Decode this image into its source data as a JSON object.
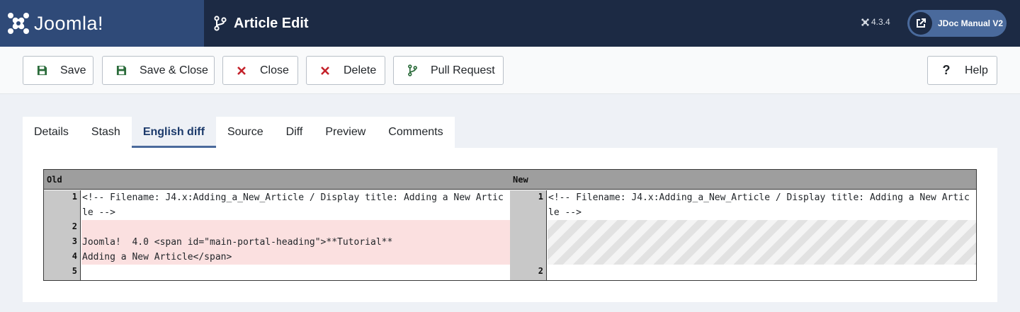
{
  "header": {
    "brand": "Joomla!",
    "title": "Article Edit",
    "version": "4.3.4",
    "manual_button": "JDoc Manual V2"
  },
  "toolbar": {
    "save": "Save",
    "save_close": "Save & Close",
    "close": "Close",
    "delete": "Delete",
    "pull_request": "Pull Request",
    "help": "Help"
  },
  "tabs": [
    {
      "label": "Details",
      "active": false
    },
    {
      "label": "Stash",
      "active": false
    },
    {
      "label": "English diff",
      "active": true
    },
    {
      "label": "Source",
      "active": false
    },
    {
      "label": "Diff",
      "active": false
    },
    {
      "label": "Preview",
      "active": false
    },
    {
      "label": "Comments",
      "active": false
    }
  ],
  "diff": {
    "old_header": "Old",
    "new_header": "New",
    "old_lines": [
      {
        "num": "1",
        "text": "<!-- Filename: J4.x:Adding_a_New_Article / Display title: Adding a New Artic",
        "cont": "le -->"
      },
      {
        "num": "2",
        "text": ""
      },
      {
        "num": "3",
        "text": "Joomla!  4.0 <span id=\"main-portal-heading\">**Tutorial**"
      },
      {
        "num": "4",
        "text": "Adding a New Article</span>"
      },
      {
        "num": "5",
        "text": ""
      }
    ],
    "new_lines": [
      {
        "num": "1",
        "text": "<!-- Filename: J4.x:Adding_a_New_Article / Display title: Adding a New Artic",
        "cont": "le -->"
      },
      {
        "num": "2",
        "text": ""
      }
    ]
  },
  "colors": {
    "header_bg": "#1c2a44",
    "brand_bg": "#2f4a78",
    "deleted_bg": "#fbe0e0",
    "save_icon": "#2a6b3a",
    "close_icon": "#c4222b"
  }
}
